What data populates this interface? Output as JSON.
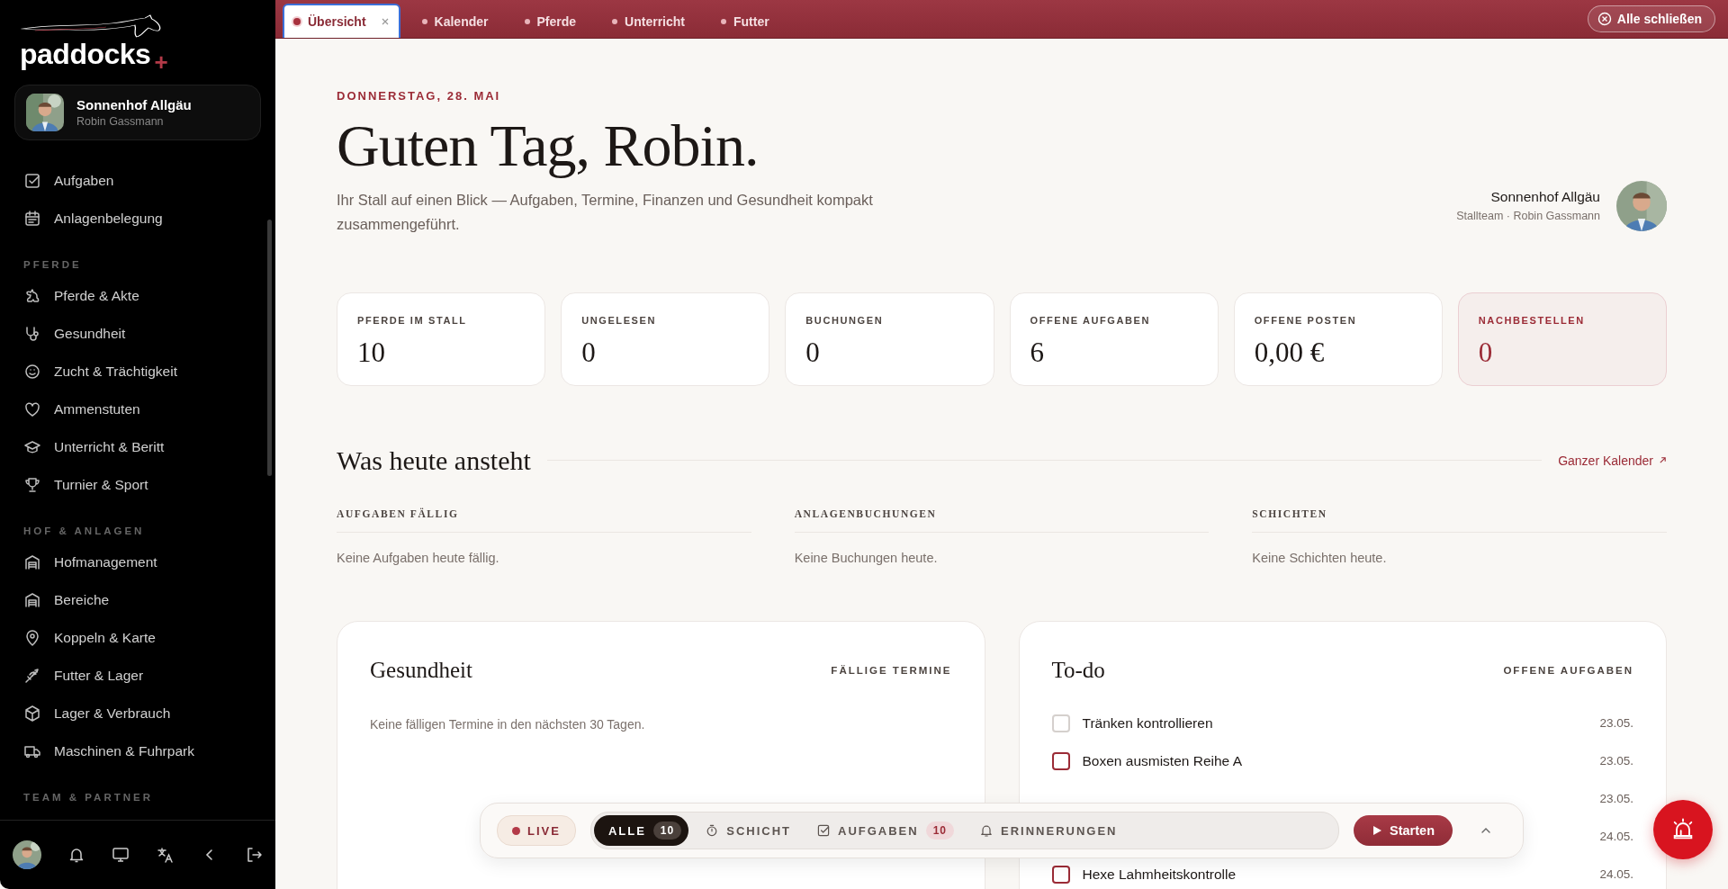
{
  "sidebar": {
    "logo": {
      "text": "paddocks",
      "mark": "+"
    },
    "profile": {
      "name": "Sonnenhof Allgäu",
      "user": "Robin Gassmann"
    },
    "sections": [
      {
        "items": [
          {
            "label": "Aufgaben"
          },
          {
            "label": "Anlagenbelegung"
          }
        ]
      },
      {
        "title": "PFERDE",
        "items": [
          {
            "label": "Pferde & Akte"
          },
          {
            "label": "Gesundheit"
          },
          {
            "label": "Zucht & Trächtigkeit"
          },
          {
            "label": "Ammenstuten"
          },
          {
            "label": "Unterricht & Beritt"
          },
          {
            "label": "Turnier & Sport"
          }
        ]
      },
      {
        "title": "HOF & ANLAGEN",
        "items": [
          {
            "label": "Hofmanagement"
          },
          {
            "label": "Bereiche"
          },
          {
            "label": "Koppeln & Karte"
          },
          {
            "label": "Futter & Lager"
          },
          {
            "label": "Lager & Verbrauch"
          },
          {
            "label": "Maschinen & Fuhrpark"
          }
        ]
      },
      {
        "title": "TEAM & PARTNER"
      }
    ]
  },
  "tabs": [
    {
      "label": "Übersicht",
      "selected": true
    },
    {
      "label": "Kalender",
      "selected": false
    },
    {
      "label": "Pferde",
      "selected": false
    },
    {
      "label": "Unterricht",
      "selected": false
    },
    {
      "label": "Futter",
      "selected": false
    }
  ],
  "close_all": "Alle schließen",
  "header": {
    "date": "DONNERSTAG, 28. MAI",
    "title": "Guten Tag, Robin.",
    "subtitle": "Ihr Stall auf einen Blick — Aufgaben, Termine, Finanzen und Gesundheit kompakt zusammengeführt.",
    "account": "Sonnenhof Allgäu",
    "role": "Stallteam · Robin Gassmann"
  },
  "stats": [
    {
      "label": "PFERDE IM STALL",
      "value": "10",
      "highlight": false
    },
    {
      "label": "UNGELESEN",
      "value": "0",
      "highlight": false
    },
    {
      "label": "BUCHUNGEN",
      "value": "0",
      "highlight": false
    },
    {
      "label": "OFFENE AUFGABEN",
      "value": "6",
      "highlight": false
    },
    {
      "label": "OFFENE POSTEN",
      "value": "0,00 €",
      "highlight": false
    },
    {
      "label": "NACHBESTELLEN",
      "value": "0",
      "highlight": true
    }
  ],
  "today": {
    "title": "Was heute ansteht",
    "link": "Ganzer Kalender",
    "columns": [
      {
        "heading": "AUFGABEN FÄLLIG",
        "empty": "Keine Aufgaben heute fällig."
      },
      {
        "heading": "ANLAGENBUCHUNGEN",
        "empty": "Keine Buchungen heute."
      },
      {
        "heading": "SCHICHTEN",
        "empty": "Keine Schichten heute."
      }
    ]
  },
  "health": {
    "title": "Gesundheit",
    "tag": "FÄLLIGE TERMINE",
    "empty": "Keine fälligen Termine in den nächsten 30 Tagen."
  },
  "todo": {
    "title": "To-do",
    "tag": "OFFENE AUFGABEN",
    "items": [
      {
        "label": "Tränken kontrollieren",
        "date": "23.05.",
        "color": "#d5d0cd"
      },
      {
        "label": "Boxen ausmisten Reihe A",
        "date": "23.05.",
        "color": "#9b2b36"
      },
      {
        "date": "23.05."
      },
      {
        "date": "24.05."
      },
      {
        "label": "Hexe Lahmheitskontrolle",
        "date": "24.05.",
        "color": "#9b2b36"
      }
    ]
  },
  "dock": {
    "live": "LIVE",
    "filters": [
      {
        "label": "ALLE",
        "count": "10",
        "selected": true
      },
      {
        "label": "SCHICHT",
        "selected": false
      },
      {
        "label": "AUFGABEN",
        "count": "10",
        "selected": false
      },
      {
        "label": "ERINNERUNGEN",
        "selected": false
      }
    ],
    "start": "Starten"
  }
}
